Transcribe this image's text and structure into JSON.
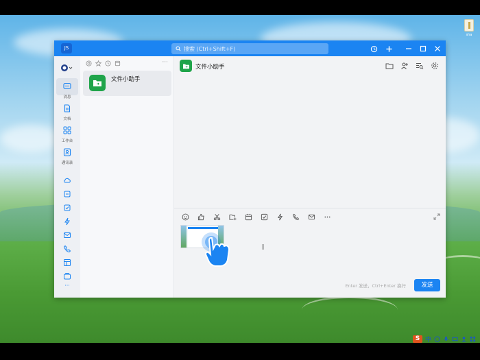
{
  "desktop": {
    "icon_label": "sha"
  },
  "taskbar": {
    "ime_badge": "S",
    "ime_label": "中"
  },
  "window": {
    "avatar_text": "JS",
    "search_placeholder": "搜索 (Ctrl+Shift+F)"
  },
  "sidebar": {
    "items": [
      {
        "label": "消息"
      },
      {
        "label": "文档"
      },
      {
        "label": "工作台"
      },
      {
        "label": "通讯录"
      }
    ],
    "more": "···"
  },
  "conversation_list": {
    "more": "···",
    "items": [
      {
        "name": "文件小助手"
      }
    ]
  },
  "chat": {
    "title": "文件小助手",
    "input_cursor": "I",
    "hint": "Enter 发送，Ctrl+Enter 换行",
    "send_label": "发送"
  },
  "colors": {
    "accent": "#1b84f2",
    "helper_green": "#1fa44a"
  }
}
